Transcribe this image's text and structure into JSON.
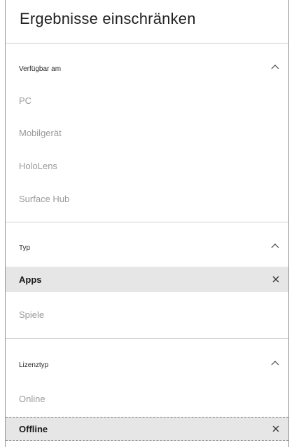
{
  "title": "Ergebnisse einschränken",
  "sections": [
    {
      "label": "Verfügbar am",
      "items": [
        "PC",
        "Mobilgerät",
        "HoloLens",
        "Surface Hub"
      ]
    },
    {
      "label": "Typ",
      "items": [
        "Apps",
        "Spiele"
      ],
      "selected": "Apps"
    },
    {
      "label": "Lizenztyp",
      "items": [
        "Online",
        "Offline"
      ],
      "selected": "Offline"
    }
  ]
}
